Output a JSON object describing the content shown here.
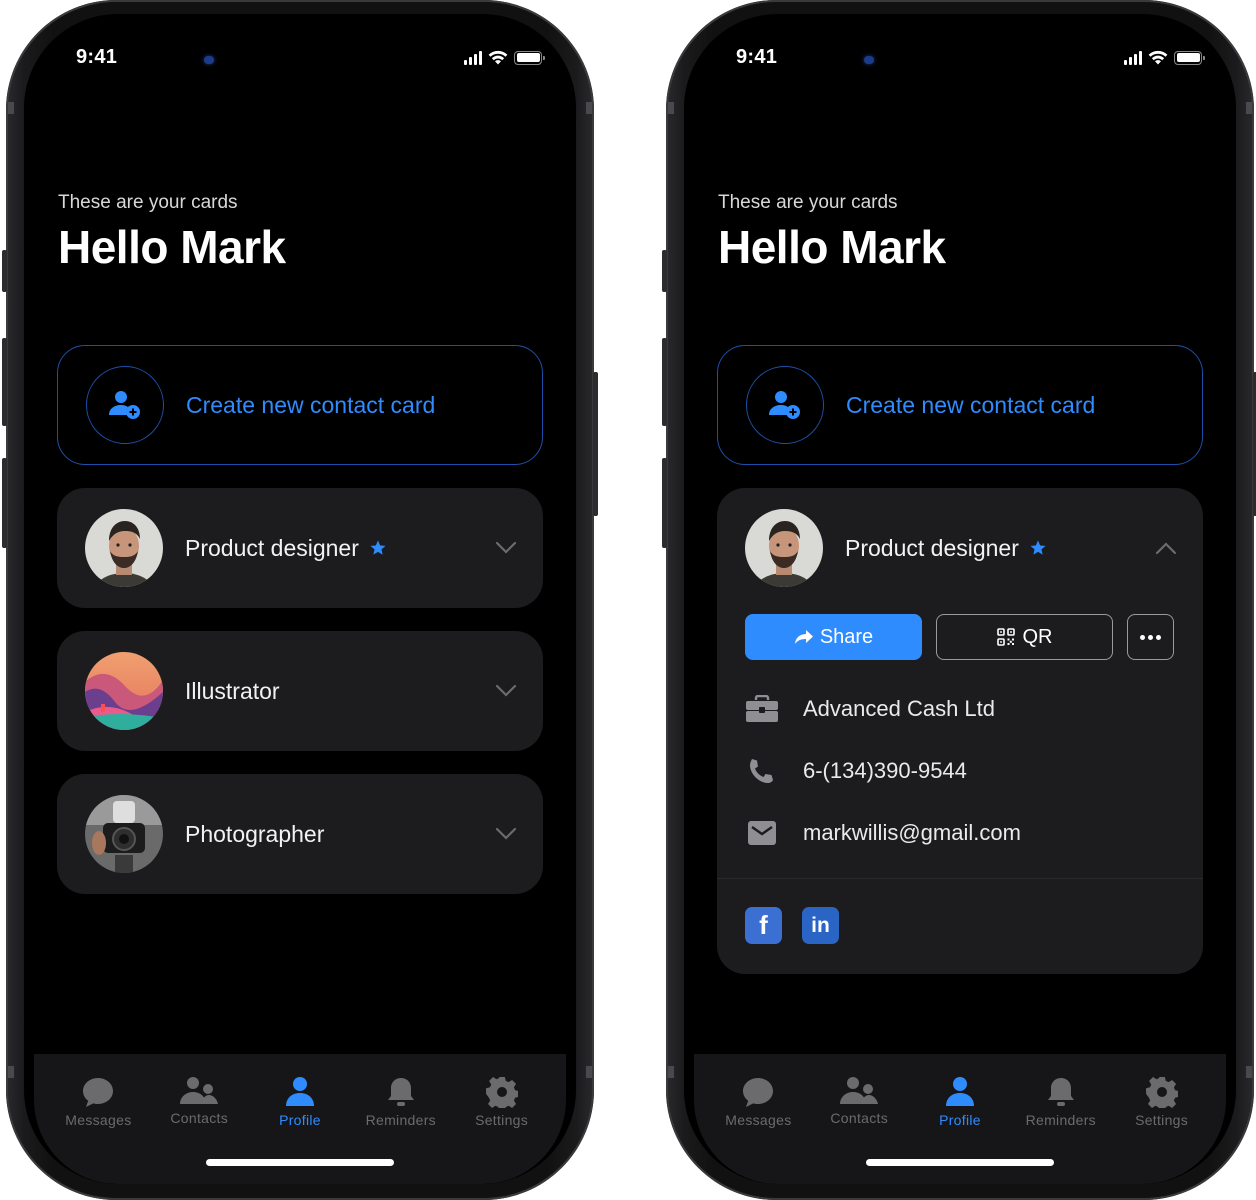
{
  "status_bar": {
    "time": "9:41"
  },
  "header": {
    "subtitle": "These are your cards",
    "title": "Hello Mark"
  },
  "create_card": {
    "label": "Create new contact card",
    "icon": "person-add-icon"
  },
  "colors": {
    "accent": "#2f8cff",
    "card_bg": "#1c1c1e",
    "screen_bg": "#000000",
    "tab_inactive": "#6b6b6e",
    "facebook": "#3b6fd1",
    "linkedin": "#2a64c4"
  },
  "left_screen": {
    "cards": [
      {
        "label": "Product designer",
        "starred": true,
        "expanded": false,
        "avatar": "portrait-man"
      },
      {
        "label": "Illustrator",
        "starred": false,
        "expanded": false,
        "avatar": "landscape-illustration"
      },
      {
        "label": "Photographer",
        "starred": false,
        "expanded": false,
        "avatar": "camera-photo"
      }
    ]
  },
  "right_screen": {
    "expanded_card": {
      "label": "Product designer",
      "starred": true,
      "expanded": true,
      "actions": {
        "share": "Share",
        "qr": "QR",
        "more": "more-options"
      },
      "company": "Advanced Cash Ltd",
      "phone": "6-(134)390-9544",
      "email": "markwillis@gmail.com",
      "social": [
        {
          "name": "facebook",
          "glyph": "f"
        },
        {
          "name": "linkedin",
          "glyph": "in"
        }
      ]
    }
  },
  "tabbar": {
    "active": "Profile",
    "tabs": [
      {
        "label": "Messages",
        "icon": "chat-bubble-icon"
      },
      {
        "label": "Contacts",
        "icon": "people-icon"
      },
      {
        "label": "Profile",
        "icon": "person-icon"
      },
      {
        "label": "Reminders",
        "icon": "bell-icon"
      },
      {
        "label": "Settings",
        "icon": "gear-icon"
      }
    ]
  }
}
